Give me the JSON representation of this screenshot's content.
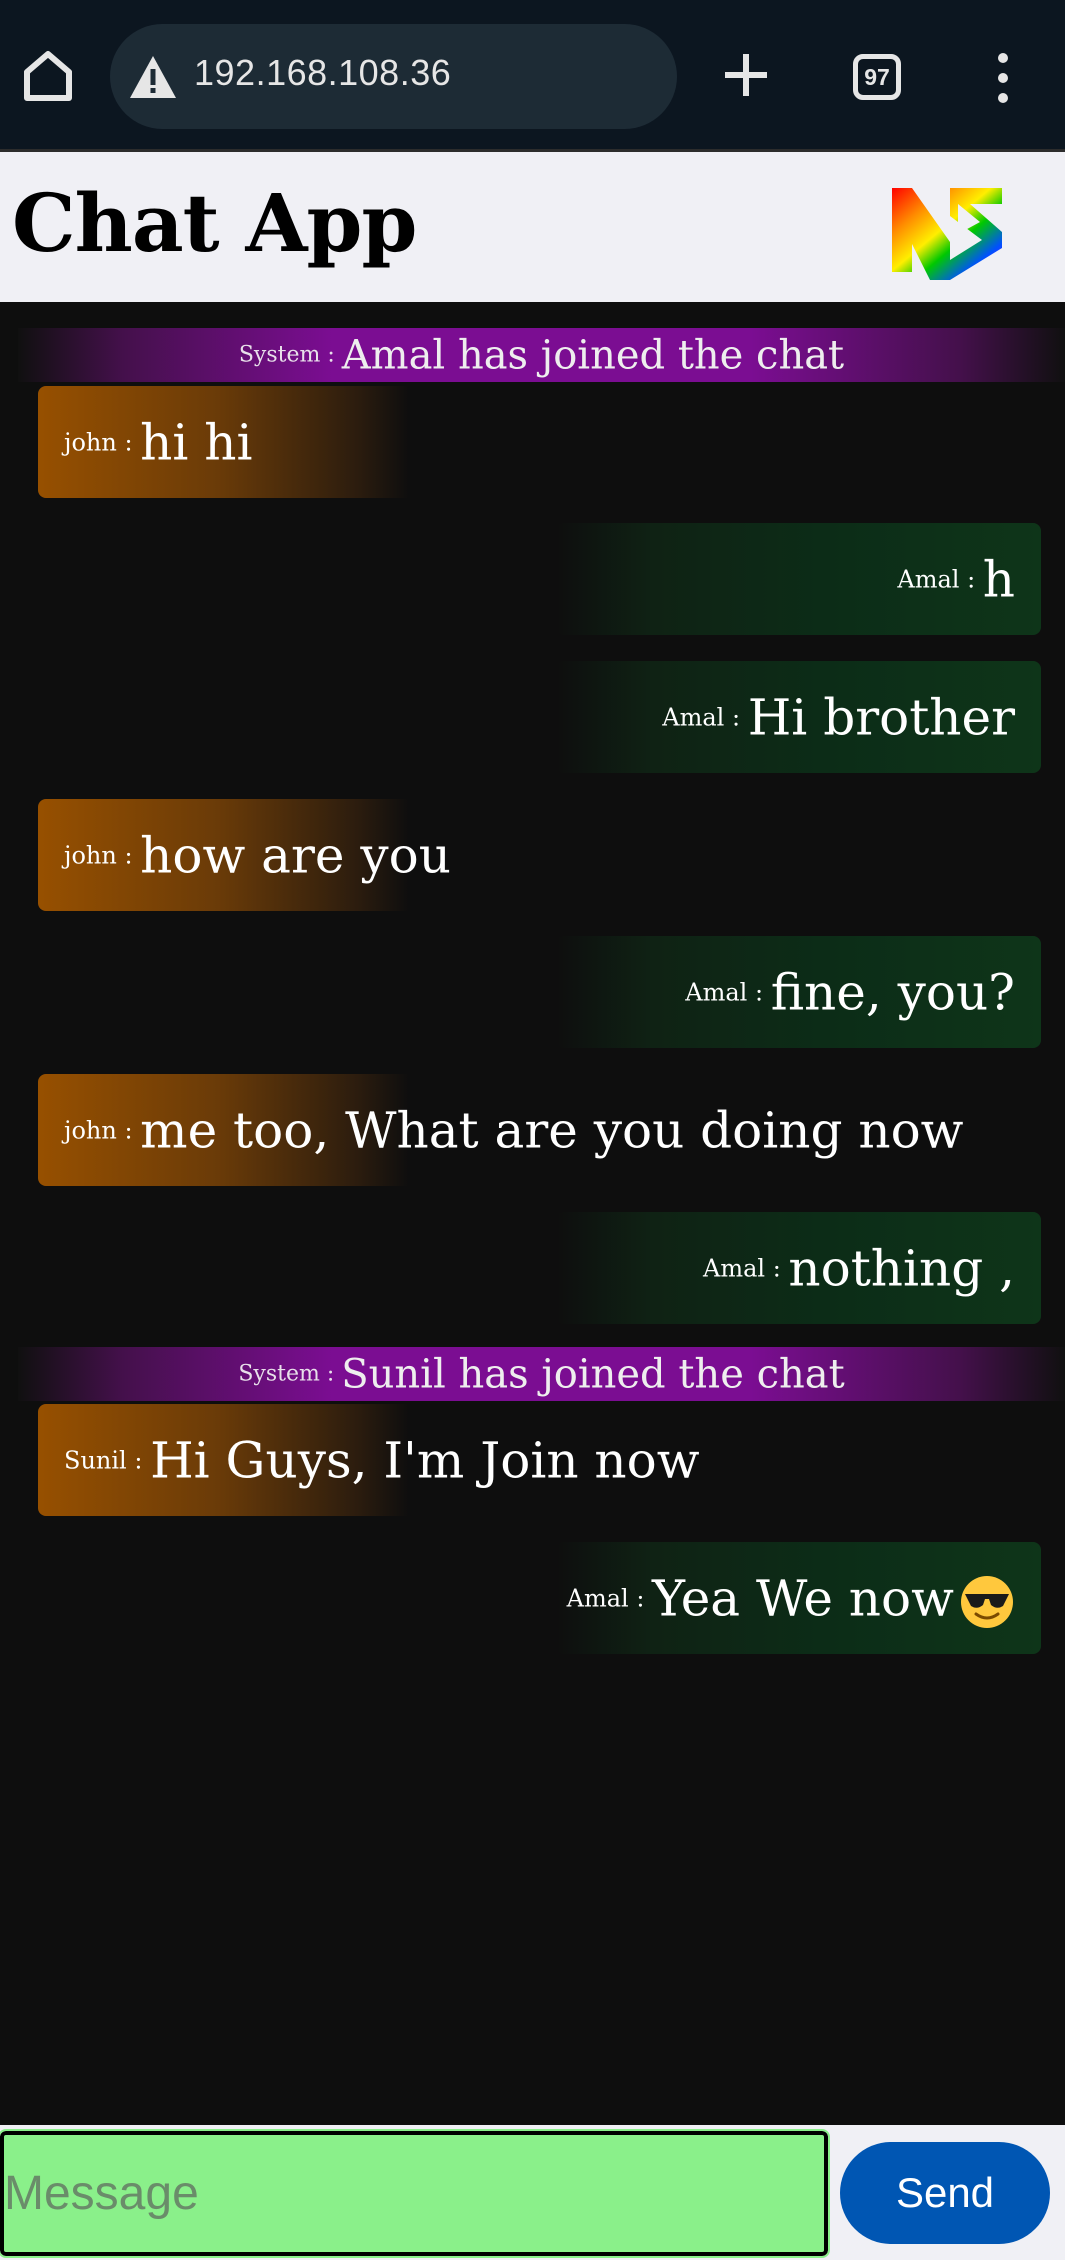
{
  "browser": {
    "url": "192.168.108.36",
    "tab_count": "97",
    "icons": [
      "home-icon",
      "warning-icon",
      "plus-icon",
      "tabs-icon",
      "more-vert-icon"
    ]
  },
  "header": {
    "title": "Chat App",
    "logo": "rainbow-ns-logo"
  },
  "messages": [
    {
      "kind": "system",
      "sender": "System",
      "text": "Amal has joined the chat"
    },
    {
      "kind": "left",
      "sender": "john",
      "text": "hi hi"
    },
    {
      "kind": "right",
      "sender": "Amal",
      "text": "h"
    },
    {
      "kind": "right",
      "sender": "Amal",
      "text": "Hi brother"
    },
    {
      "kind": "left",
      "sender": "john",
      "text": "how are you"
    },
    {
      "kind": "right",
      "sender": "Amal",
      "text": "fine, you?"
    },
    {
      "kind": "left",
      "sender": "john",
      "text": "me too, What are you doing now"
    },
    {
      "kind": "right",
      "sender": "Amal",
      "text": "nothing ,"
    },
    {
      "kind": "system",
      "sender": "System",
      "text": "Sunil has joined the chat"
    },
    {
      "kind": "left",
      "sender": "Sunil",
      "text": "Hi Guys, I'm Join now"
    },
    {
      "kind": "right",
      "sender": "Amal",
      "text": "Yea We now",
      "emoji": "sunglasses-emoji-icon"
    }
  ],
  "separator": " : ",
  "composer": {
    "placeholder": "Message",
    "value": "",
    "send_label": "Send"
  },
  "colors": {
    "system": "#7b0d92",
    "left": "#975000",
    "right": "#0e3519",
    "input_bg": "#8af08a",
    "send_bg": "#0056b3"
  }
}
